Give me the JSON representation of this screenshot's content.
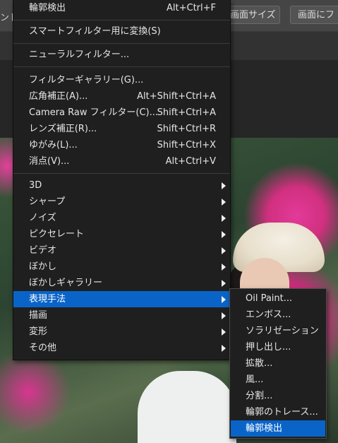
{
  "options_bar": {
    "left_text": "ンド",
    "button1": "画面サイズ",
    "button2": "画面にフ"
  },
  "filter_menu": {
    "items": [
      {
        "label": "輪郭検出",
        "shortcut": "Alt+Ctrl+F"
      },
      {
        "label": "スマートフィルター用に変換(S)",
        "shortcut": ""
      },
      {
        "label": "ニューラルフィルター...",
        "shortcut": ""
      },
      {
        "label": "フィルターギャラリー(G)...",
        "shortcut": ""
      },
      {
        "label": "広角補正(A)...",
        "shortcut": "Alt+Shift+Ctrl+A"
      },
      {
        "label": "Camera Raw フィルター(C)...",
        "shortcut": "Shift+Ctrl+A"
      },
      {
        "label": "レンズ補正(R)...",
        "shortcut": "Shift+Ctrl+R"
      },
      {
        "label": "ゆがみ(L)...",
        "shortcut": "Shift+Ctrl+X"
      },
      {
        "label": "消点(V)...",
        "shortcut": "Alt+Ctrl+V"
      },
      {
        "label": "3D",
        "shortcut": ""
      },
      {
        "label": "シャープ",
        "shortcut": ""
      },
      {
        "label": "ノイズ",
        "shortcut": ""
      },
      {
        "label": "ピクセレート",
        "shortcut": ""
      },
      {
        "label": "ビデオ",
        "shortcut": ""
      },
      {
        "label": "ぼかし",
        "shortcut": ""
      },
      {
        "label": "ぼかしギャラリー",
        "shortcut": ""
      },
      {
        "label": "表現手法",
        "shortcut": ""
      },
      {
        "label": "描画",
        "shortcut": ""
      },
      {
        "label": "変形",
        "shortcut": ""
      },
      {
        "label": "その他",
        "shortcut": ""
      }
    ]
  },
  "stylize_submenu": {
    "items": [
      {
        "label": "Oil Paint..."
      },
      {
        "label": "エンボス..."
      },
      {
        "label": "ソラリゼーション"
      },
      {
        "label": "押し出し..."
      },
      {
        "label": "拡散..."
      },
      {
        "label": "風..."
      },
      {
        "label": "分割..."
      },
      {
        "label": "輪郭のトレース..."
      },
      {
        "label": "輪郭検出"
      }
    ]
  },
  "colors": {
    "highlight": "#0a64c8",
    "menu_bg": "#1f1f1f"
  }
}
